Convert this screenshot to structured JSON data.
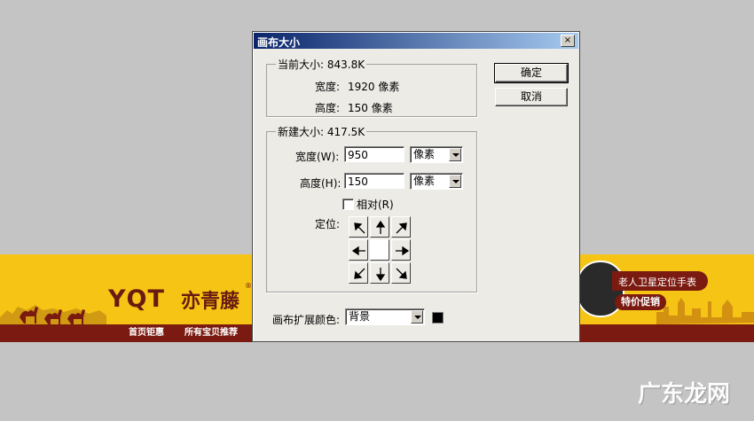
{
  "banner": {
    "logo_text": "YQT",
    "logo_cn": "亦青藤",
    "reg": "®",
    "nav": [
      "首页钜惠",
      "所有宝贝推荐"
    ],
    "promo_title": "老人卫星定位手表",
    "promo_button": "特价促销",
    "watermark": "广东龙网"
  },
  "dialog": {
    "title": "画布大小",
    "close": "×",
    "current": {
      "legend": "当前大小: 843.8K",
      "width_label": "宽度:",
      "width_value": "1920 像素",
      "height_label": "高度:",
      "height_value": "150 像素"
    },
    "new": {
      "legend": "新建大小: 417.5K",
      "width_label": "宽度(W):",
      "width_value": "950",
      "width_unit": "像素",
      "height_label": "高度(H):",
      "height_value": "150",
      "height_unit": "像素",
      "relative_label": "相对(R)",
      "relative_checked": false,
      "anchor_label": "定位:",
      "anchor_selected": "center"
    },
    "ok_button": "确定",
    "cancel_button": "取消",
    "extension_label": "画布扩展颜色:",
    "extension_value": "背景",
    "extension_swatch": "#000000"
  }
}
